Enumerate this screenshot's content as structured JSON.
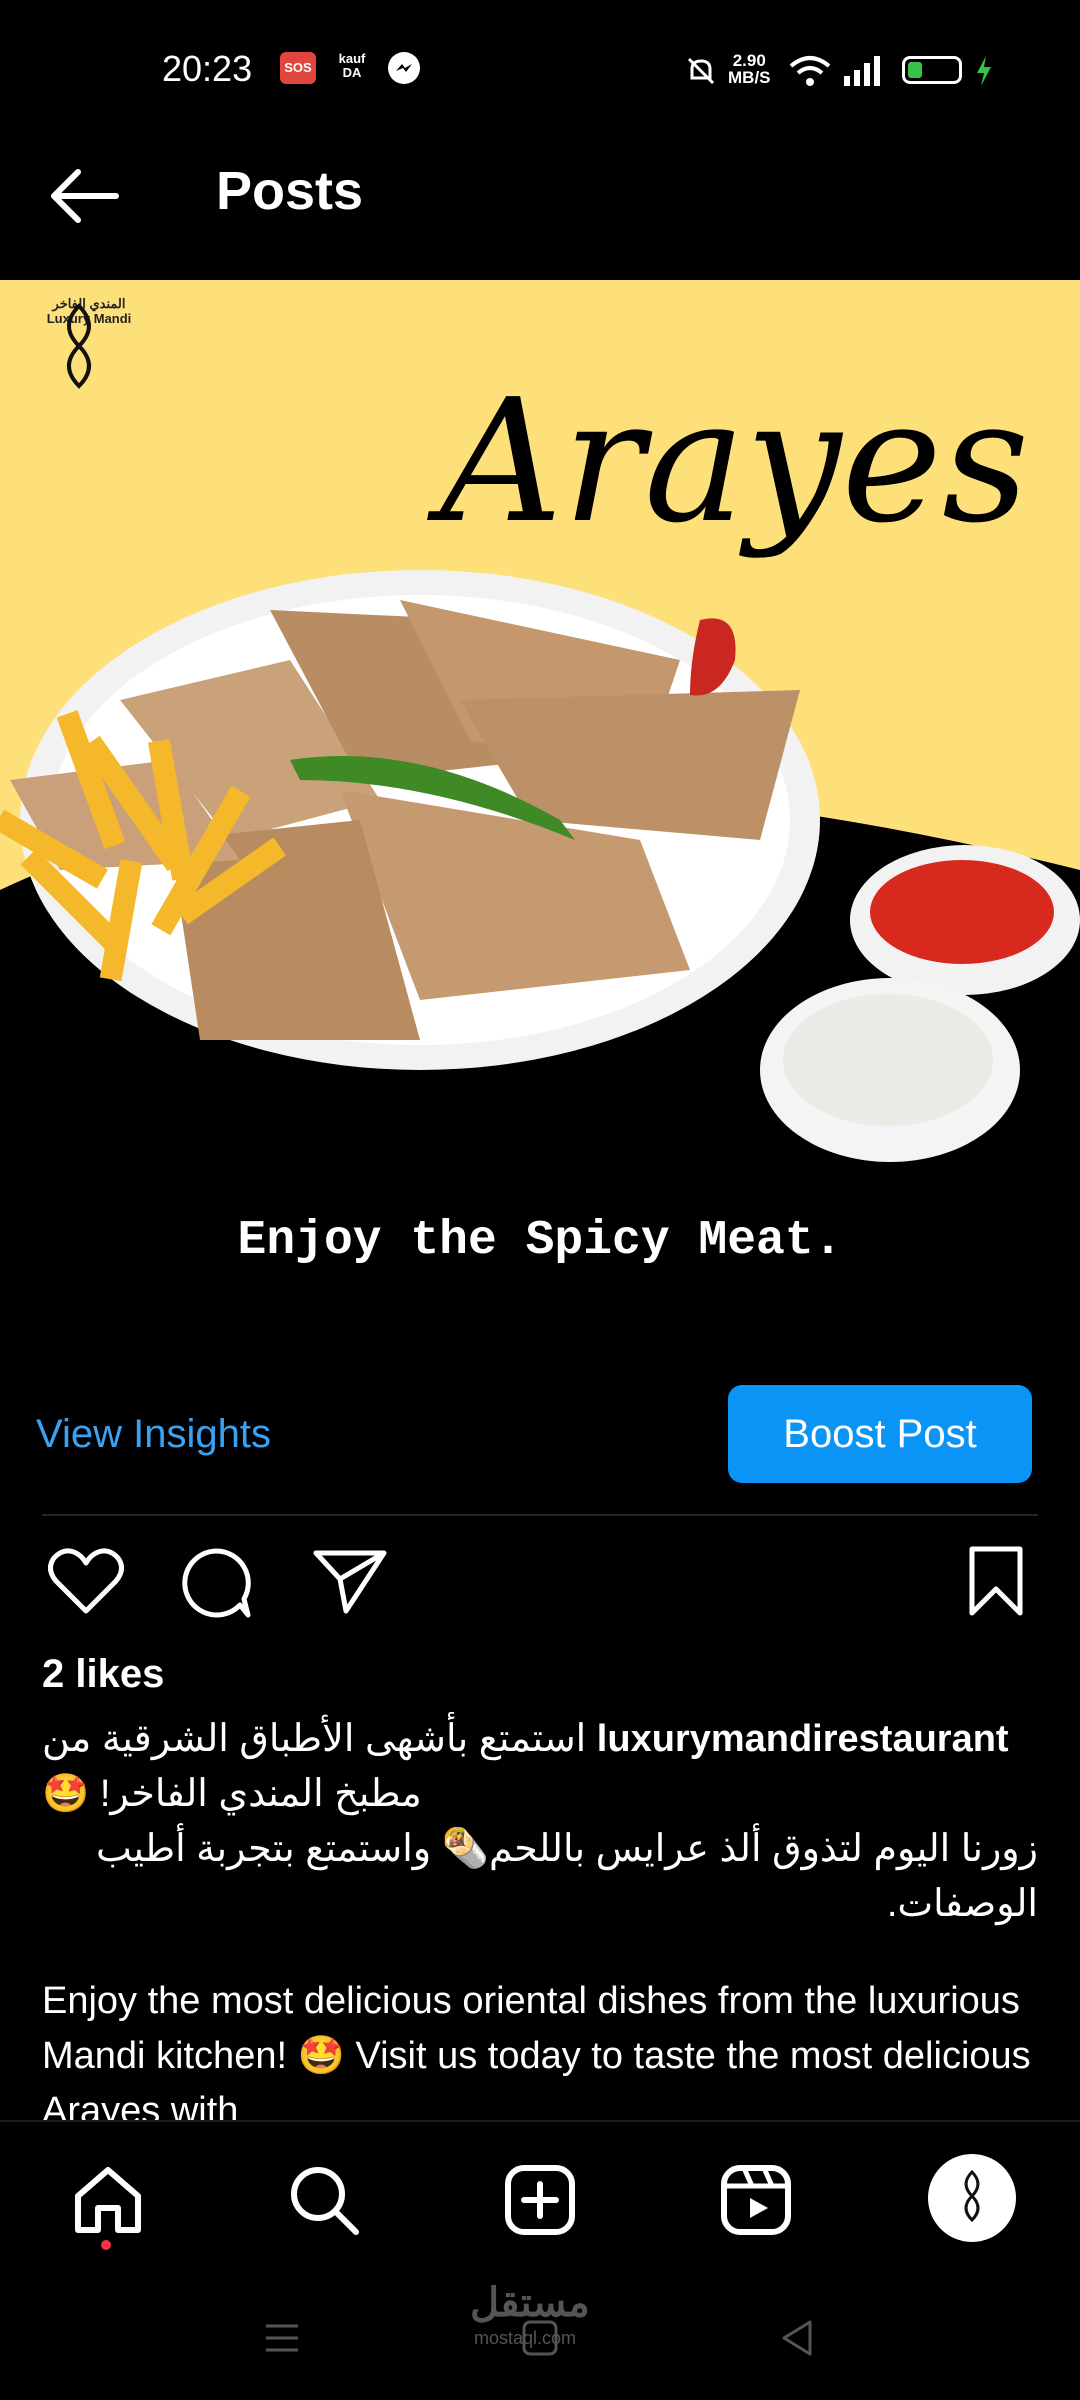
{
  "status_bar": {
    "time": "20:23",
    "sos_label": "SOS",
    "kauf_label": "kauf\nDA",
    "speed_value": "2.90",
    "speed_unit": "MB/S",
    "icons": [
      "sos-icon",
      "kaufda-icon",
      "messenger-icon",
      "mute-icon",
      "wifi-icon",
      "signal-icon",
      "battery-icon",
      "charging-icon"
    ]
  },
  "header": {
    "title": "Posts"
  },
  "post": {
    "image": {
      "logo_text_ar": "المندي الفاخر",
      "logo_text_en": "Luxury Mandi",
      "script_title": "Arayes",
      "headline": "Enjoy the Spicy Meat."
    },
    "insights_label": "View Insights",
    "boost_label": "Boost Post",
    "likes": "2 likes",
    "caption": {
      "username": "luxurymandirestaurant",
      "arabic_line1": "استمتع بأشهى الأطباق الشرقية من مطبخ المندي الفاخر! 🤩",
      "arabic_line2": "زورنا اليوم لتذوق ألذ عرايس باللحم🌯 واستمتع بتجربة أطيب الوصفات.",
      "english": "Enjoy the most delicious oriental dishes from the luxurious Mandi kitchen! 🤩 Visit us today to taste the most delicious Arayes with"
    }
  },
  "bottom_nav": {
    "items": [
      "home-icon",
      "search-icon",
      "create-icon",
      "reels-icon",
      "profile-avatar"
    ],
    "active": "home"
  },
  "watermark": {
    "text_ar": "مستقل",
    "text_en": "mostaql.com"
  },
  "colors": {
    "background": "#000000",
    "banner_yellow": "#fde07a",
    "link_blue": "#3aa2f2",
    "button_blue": "#0a95f6",
    "notification_red": "#ff3040"
  }
}
